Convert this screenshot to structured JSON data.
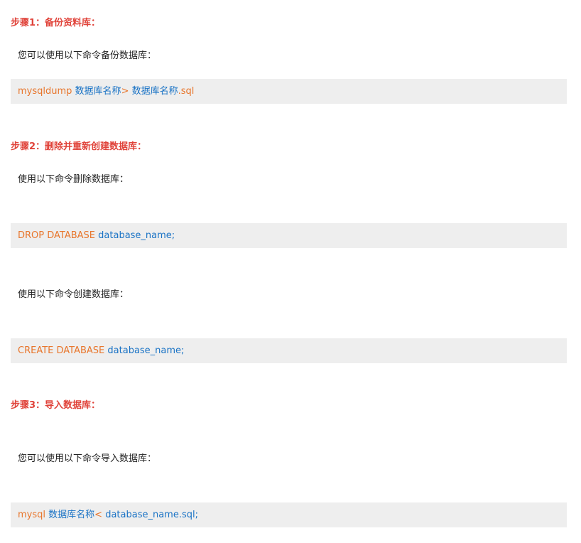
{
  "sections": [
    {
      "heading": "步骤1：备份资料库：",
      "text": "您可以使用以下命令备份数据库：",
      "code": [
        {
          "kw": "mysqldump ",
          "id": "数据库名称",
          "kw2": "> ",
          "id2": "数据库名称",
          "kw3": ".sql"
        }
      ]
    },
    {
      "heading": "步骤2：删除并重新创建数据库：",
      "text_drop": "使用以下命令删除数据库：",
      "code_drop": {
        "kw": "DROP DATABASE ",
        "id": "database_name;"
      },
      "text_create": "使用以下命令创建数据库：",
      "code_create": {
        "kw": "CREATE DATABASE ",
        "id": "database_name;"
      }
    },
    {
      "heading": "步骤3：导入数据库：",
      "text": "您可以使用以下命令导入数据库：",
      "code": {
        "kw": "mysql ",
        "id": "数据库名称",
        "kw2": "< ",
        "id2": "database_name.sql;"
      }
    }
  ],
  "colors": {
    "heading": "#e0433a",
    "keyword": "#e8762c",
    "identifier": "#1a73c5",
    "code_bg": "#eeeeee"
  }
}
